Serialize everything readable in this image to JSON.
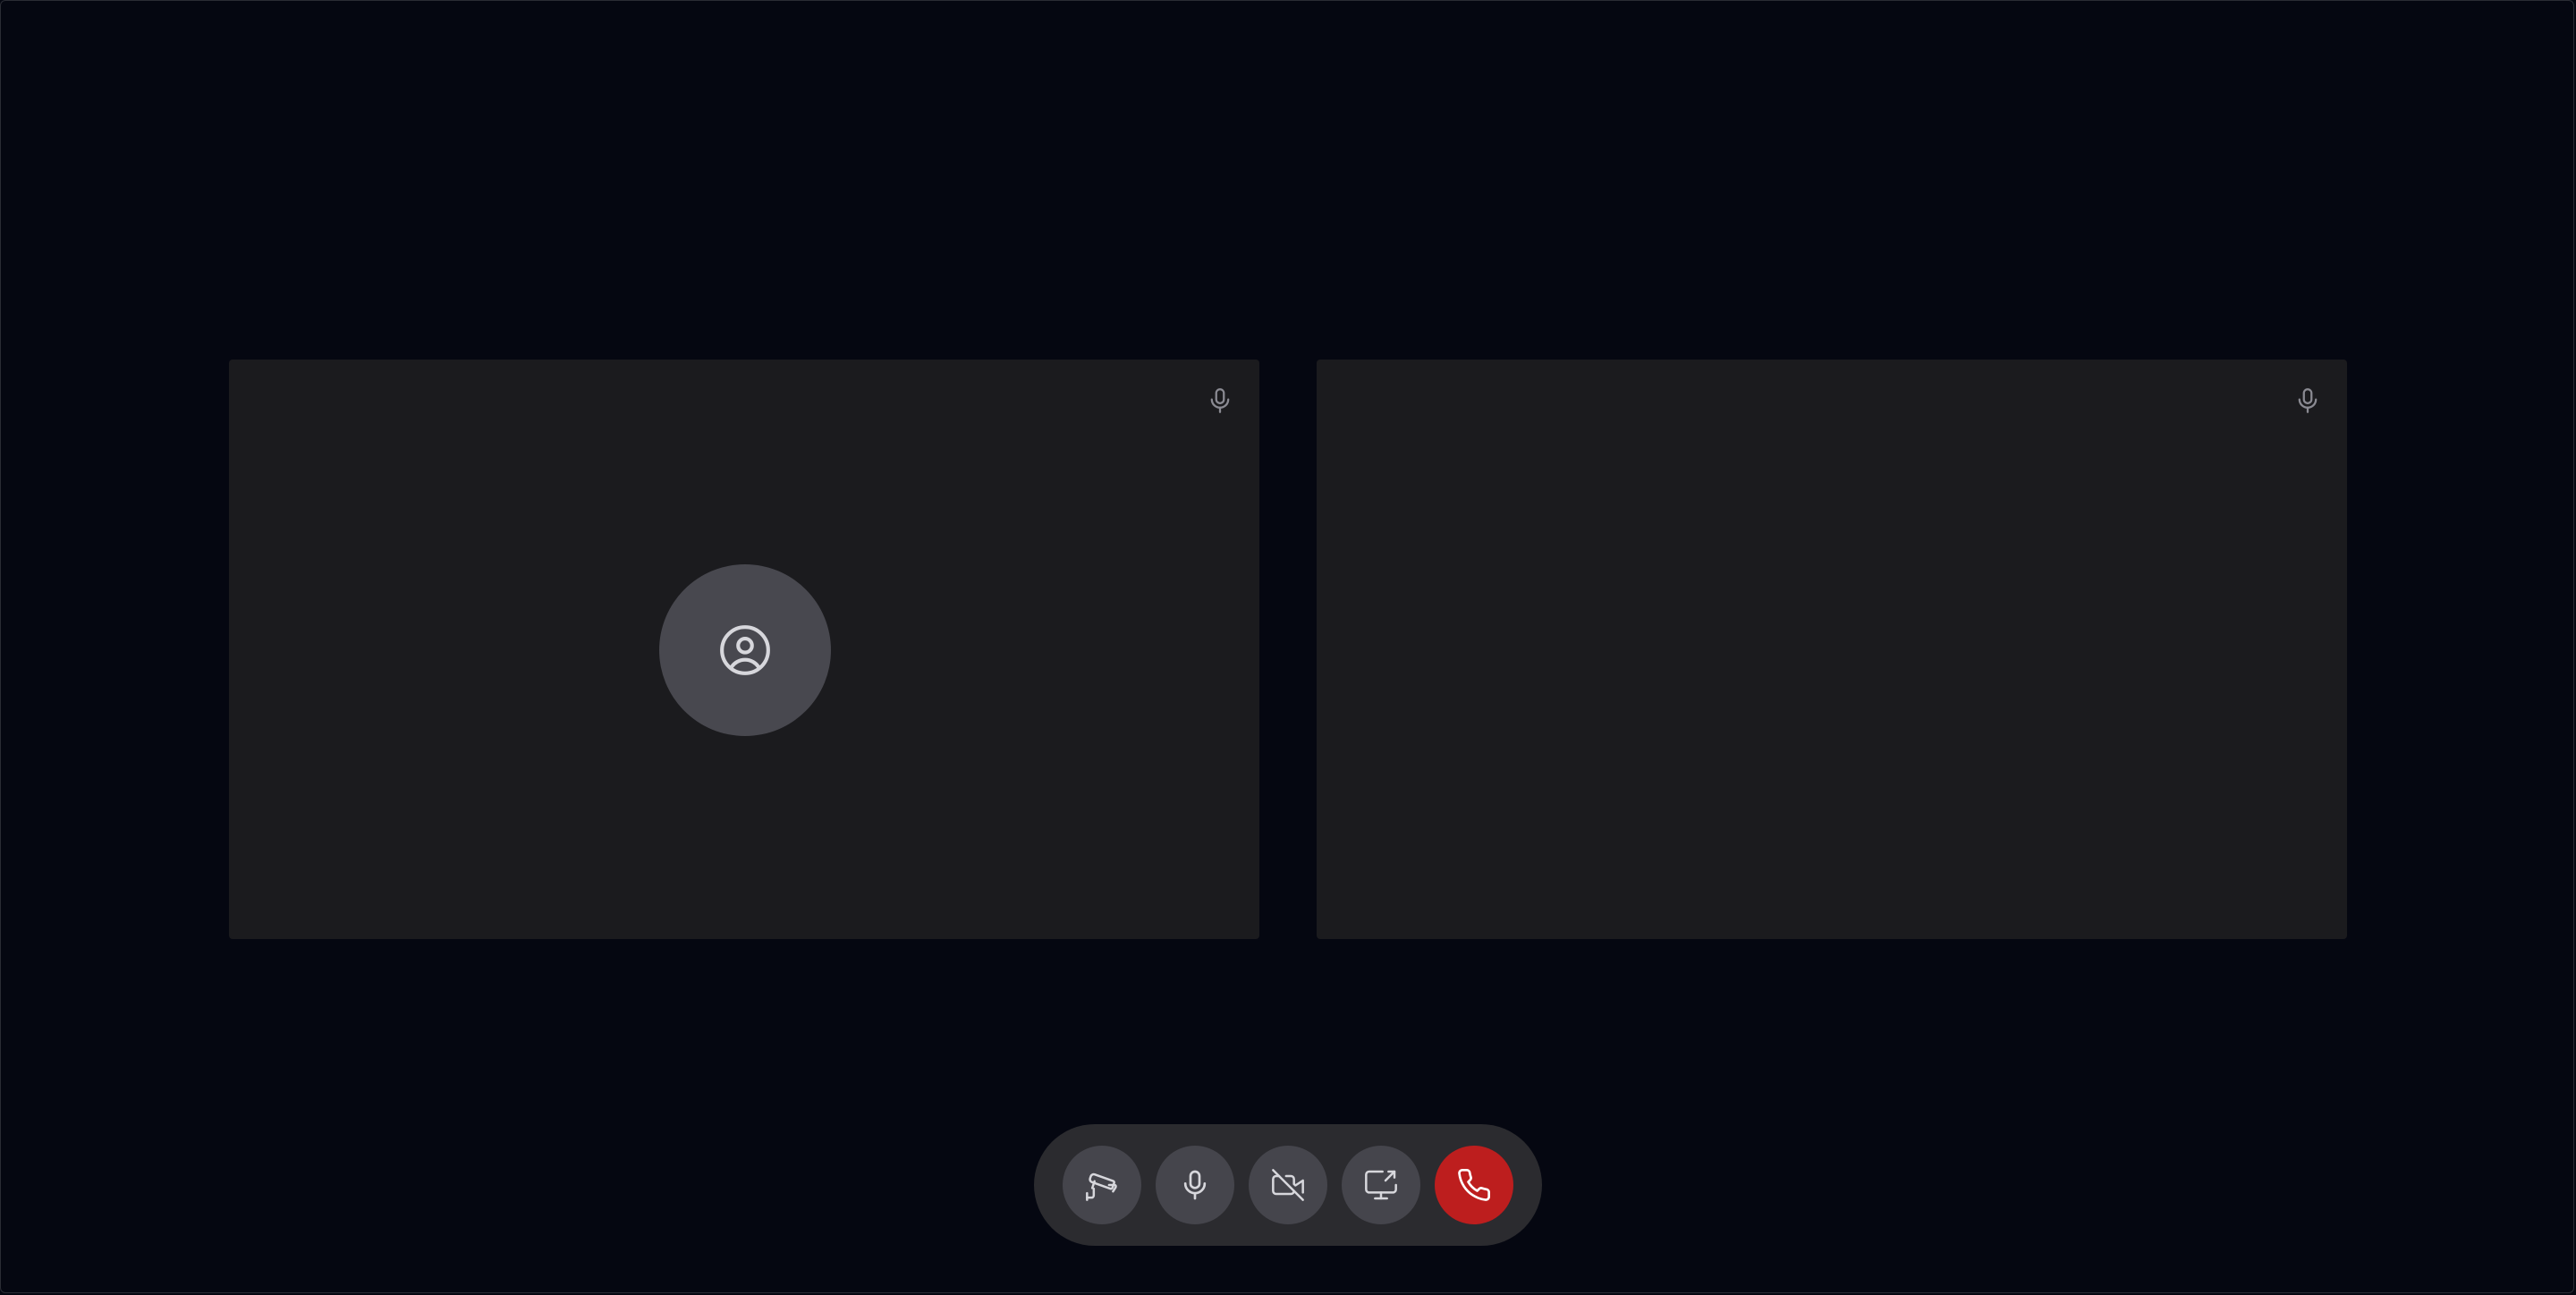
{
  "colors": {
    "background": "#050711",
    "tile": "#1b1b1e",
    "avatar": "#48484f",
    "control_bar": "#2b2b2f",
    "control_button": "#45454c",
    "hangup": "#bd1e1e",
    "icon": "#d7d7dc"
  },
  "tiles": [
    {
      "id": "local",
      "mic_icon": "microphone-icon",
      "avatar_icon": "user-circle-icon",
      "has_avatar": true
    },
    {
      "id": "remote",
      "mic_icon": "microphone-icon",
      "has_avatar": false
    }
  ],
  "controls": [
    {
      "name": "camera-switch-button",
      "icon": "cctv-camera-icon"
    },
    {
      "name": "microphone-toggle-button",
      "icon": "microphone-icon"
    },
    {
      "name": "video-toggle-button",
      "icon": "video-off-icon"
    },
    {
      "name": "screen-share-button",
      "icon": "screen-share-icon"
    },
    {
      "name": "end-call-button",
      "icon": "phone-icon"
    }
  ]
}
